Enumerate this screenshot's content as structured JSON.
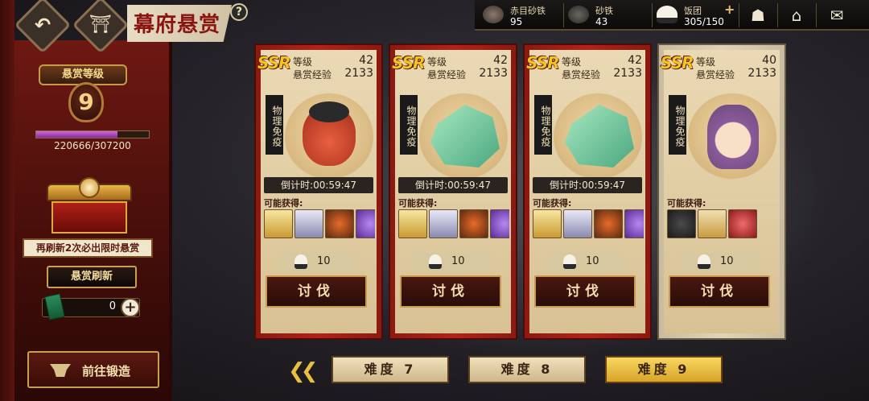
{
  "title": "幕府悬赏",
  "top_resources": [
    {
      "name": "赤目砂铁",
      "value": "95"
    },
    {
      "name": "砂铁",
      "value": "43"
    },
    {
      "name": "饭团",
      "value": "305/150"
    }
  ],
  "left_panel": {
    "level_title": "悬赏等级",
    "level": "9",
    "exp_text": "220666/307200",
    "exp_ratio": 0.718,
    "refresh_note": "再刷新2次必出限时悬赏",
    "refresh_button": "悬赏刷新",
    "scroll_count": "0",
    "forge_button": "前往锻造"
  },
  "cards": [
    {
      "rarity": "SSR",
      "level_label": "等级",
      "level": "42",
      "exp_label": "悬赏经验",
      "exp": "2133",
      "tag": "物理免疫",
      "countdown_label": "倒计时:",
      "countdown": "00:59:47",
      "may_get": "可能获得:",
      "cost": "10",
      "button": "讨伐"
    },
    {
      "rarity": "SSR",
      "level_label": "等级",
      "level": "42",
      "exp_label": "悬赏经验",
      "exp": "2133",
      "tag": "物理免疫",
      "countdown_label": "倒计时:",
      "countdown": "00:59:47",
      "may_get": "可能获得:",
      "cost": "10",
      "button": "讨伐"
    },
    {
      "rarity": "SSR",
      "level_label": "等级",
      "level": "42",
      "exp_label": "悬赏经验",
      "exp": "2133",
      "tag": "物理免疫",
      "countdown_label": "倒计时:",
      "countdown": "00:59:47",
      "may_get": "可能获得:",
      "cost": "10",
      "button": "讨伐"
    },
    {
      "rarity": "SSR",
      "level_label": "等级",
      "level": "40",
      "exp_label": "悬赏经验",
      "exp": "2133",
      "tag": "物理免疫",
      "may_get": "可能获得:",
      "cost": "10",
      "button": "讨伐"
    }
  ],
  "difficulty": [
    {
      "label": "难度 7"
    },
    {
      "label": "难度 8"
    },
    {
      "label": "难度 9",
      "active": true
    }
  ],
  "colors": {
    "accent": "#b02418",
    "gold": "#f4c420",
    "purple_bar": "#b040c8"
  }
}
